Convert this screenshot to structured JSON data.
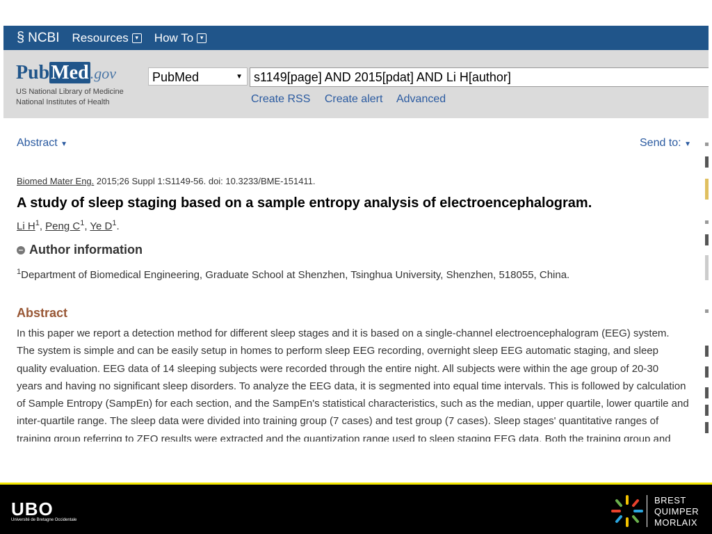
{
  "ncbi": {
    "logo": "NCBI",
    "resources": "Resources",
    "how_to": "How To"
  },
  "logo": {
    "pub": "Pub",
    "med": "Med",
    "gov": ".gov",
    "sub1": "US National Library of Medicine",
    "sub2": "National Institutes of Health"
  },
  "search": {
    "database": "PubMed",
    "query": "s1149[page] AND 2015[pdat] AND Li H[author]",
    "links": [
      "Create RSS",
      "Create alert",
      "Advanced"
    ]
  },
  "display": {
    "format": "Abstract",
    "send_to": "Send to:"
  },
  "article": {
    "journal": "Biomed Mater Eng.",
    "citation": " 2015;26 Suppl 1:S1149-56. doi: 10.3233/BME-151411.",
    "title": "A study of sleep staging based on a sample entropy analysis of electroencephalogram.",
    "authors": [
      {
        "name": "Li H",
        "sup": "1"
      },
      {
        "name": "Peng C",
        "sup": "1"
      },
      {
        "name": "Ye D",
        "sup": "1"
      }
    ],
    "author_info_label": "Author information",
    "affiliation_sup": "1",
    "affiliation": "Department of Biomedical Engineering, Graduate School at Shenzhen, Tsinghua University, Shenzhen, 518055, China.",
    "abstract_heading": "Abstract",
    "abstract_lines": [
      "In this paper we report a detection method for different sleep stages and it is based on a single-channel electroencephalogram (EEG) system.",
      "The system is simple and can be easily setup in homes to perform sleep EEG recording, overnight sleep EEG automatic staging, and sleep",
      "quality evaluation. EEG data of 14 sleeping subjects were recorded through the entire night. All subjects were within the age group of 20-30",
      "years and having no significant sleep disorders. To analyze the EEG data, it is segmented into equal time intervals. This is followed by calculation",
      "of Sample Entropy (SampEn) for each section, and the SampEn's statistical characteristics, such as the median, upper quartile, lower quartile and",
      "inter-quartile range. The sleep data were divided into training group (7 cases) and test group (7 cases). Sleep stages' quantitative ranges of",
      "training group referring to ZEO results were extracted and the quantization range used to sleep staging EEG data. Both the training group and"
    ]
  },
  "footer": {
    "brand": "UBO",
    "brand_sub": "Université de Bretagne Occidentale",
    "cities": [
      "BREST",
      "QUIMPER",
      "MORLAIX"
    ]
  },
  "colors": {
    "ncbi_bar": "#20558a",
    "link": "#2a5aa0",
    "abstract_heading": "#985735",
    "footer_accent": "#f3e600"
  }
}
